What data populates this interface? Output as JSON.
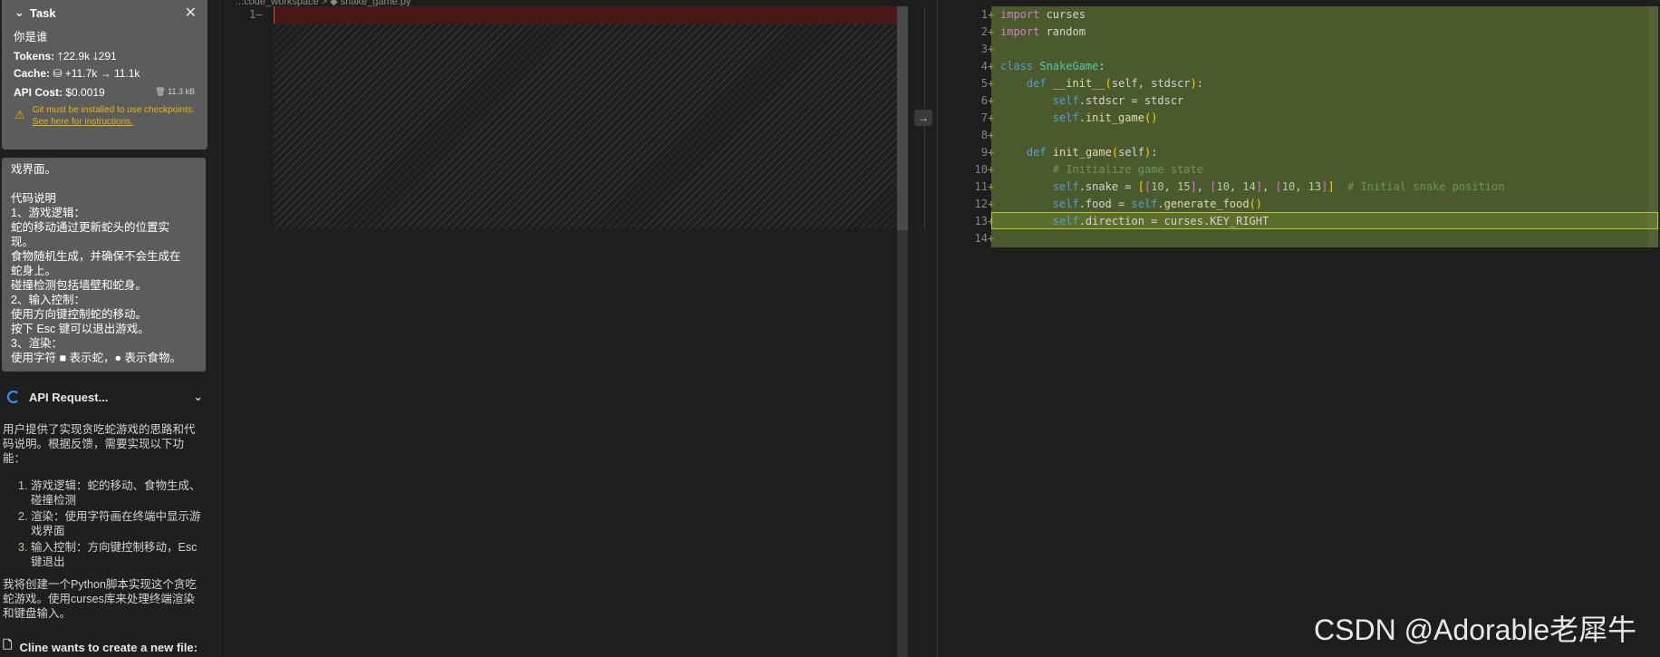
{
  "task": {
    "title": "Task",
    "query": "你是谁",
    "tokens_label": "Tokens:",
    "tokens_up": "22.9k",
    "tokens_down": "291",
    "cache_label": "Cache:",
    "cache_write": "+11.7k",
    "cache_read": "11.1k",
    "cost_label": "API Cost:",
    "cost_value": "$0.0019",
    "size_badge": "11.3 kB",
    "warn_text": "Git must be installed to use checkpoints.",
    "warn_link": "See here for instructions."
  },
  "card_lines": [
    "戏界面。",
    "",
    "代码说明",
    "1、游戏逻辑：",
    "蛇的移动通过更新蛇头的位置实",
    "现。",
    "食物随机生成，并确保不会生成在",
    "蛇身上。",
    "碰撞检测包括墙壁和蛇身。",
    "2、输入控制：",
    "使用方向键控制蛇的移动。",
    "按下 Esc 键可以退出游戏。",
    "3、渲染：",
    "使用字符 ■ 表示蛇，● 表示食物。"
  ],
  "api_request": {
    "label": "API Request...",
    "intro": "用户提供了实现贪吃蛇游戏的思路和代码说明。根据反馈，需要实现以下功能：",
    "items": [
      "游戏逻辑：蛇的移动、食物生成、碰撞检测",
      "渲染：使用字符画在终端中显示游戏界面",
      "输入控制：方向键控制移动，Esc键退出"
    ],
    "outro": "我将创建一个Python脚本实现这个贪吃蛇游戏。使用curses库来处理终端渲染和键盘输入。",
    "new_file": "Cline wants to create a new file:"
  },
  "left_editor": {
    "breadcrumb": "...code_workspace > ◆ snake_game.py",
    "line": "1"
  },
  "code_lines": [
    {
      "n": "1",
      "html": "<span class='kw'>import</span> curses"
    },
    {
      "n": "2",
      "html": "<span class='kw'>import</span> random"
    },
    {
      "n": "3",
      "html": ""
    },
    {
      "n": "4",
      "html": "<span class='kw2'>class</span> <span class='cls'>SnakeGame</span>:"
    },
    {
      "n": "5",
      "html": "    <span class='kw2'>def</span> <span class='fn'>__init__</span><span class='br1'>(</span>self, stdscr<span class='br1'>)</span>:"
    },
    {
      "n": "6",
      "html": "        <span class='slf'>self</span>.stdscr = stdscr"
    },
    {
      "n": "7",
      "html": "        <span class='slf'>self</span>.<span class='fn'>init_game</span><span class='br1'>()</span>"
    },
    {
      "n": "8",
      "html": ""
    },
    {
      "n": "9",
      "html": "    <span class='kw2'>def</span> <span class='fn'>init_game</span><span class='br1'>(</span>self<span class='br1'>)</span>:"
    },
    {
      "n": "10",
      "html": "        <span class='cmt'># Initialize game state</span>"
    },
    {
      "n": "11",
      "html": "        <span class='slf'>self</span>.snake = <span class='br1'>[</span><span class='br2'>[</span><span class='num'>10</span>, <span class='num'>15</span><span class='br2'>]</span>, <span class='br2'>[</span><span class='num'>10</span>, <span class='num'>14</span><span class='br2'>]</span>, <span class='br2'>[</span><span class='num'>10</span>, <span class='num'>13</span><span class='br2'>]</span><span class='br1'>]</span>  <span class='cmt'># Initial snake position</span>"
    },
    {
      "n": "12",
      "html": "        <span class='slf'>self</span>.food = <span class='slf'>self</span>.<span class='fn'>generate_food</span><span class='br1'>()</span>"
    },
    {
      "n": "13",
      "html": "        <span class='slf'>self</span>.direction = curses.KEY_RIGHT"
    },
    {
      "n": "14",
      "html": ""
    }
  ],
  "watermark": "CSDN @Adorable老犀牛",
  "colors": {
    "added_bg": "#4b5a2c",
    "removed_bg": "#4b1818",
    "accent": "#3794ff"
  }
}
